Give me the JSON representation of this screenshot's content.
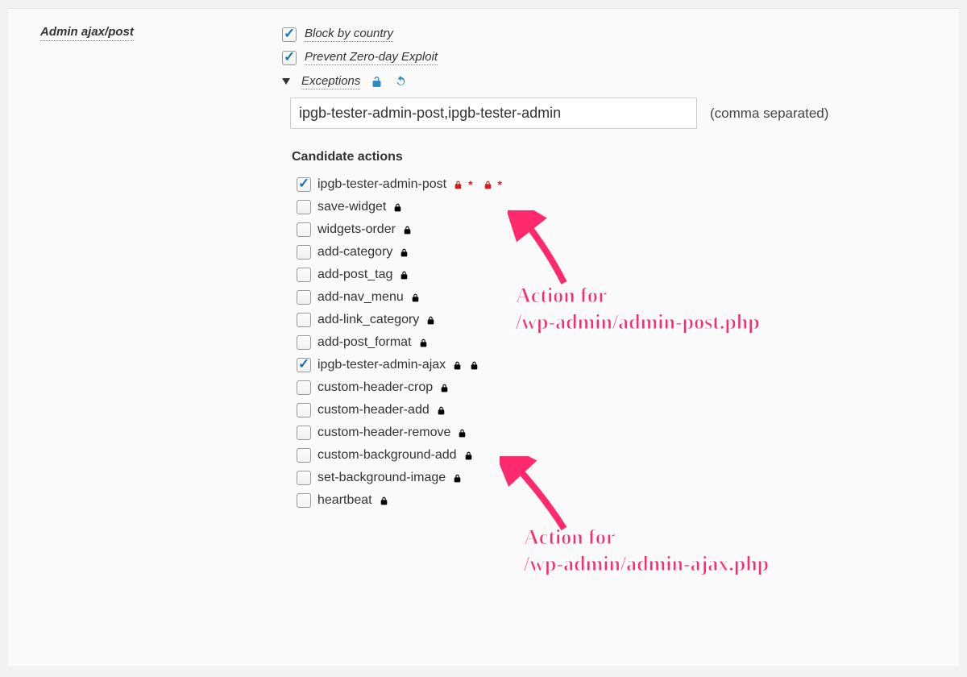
{
  "section_title": "Admin ajax/post",
  "options": {
    "block_label": "Block by country",
    "block_checked": true,
    "prevent_label": "Prevent Zero-day Exploit",
    "prevent_checked": true
  },
  "exceptions": {
    "label": "Exceptions",
    "value": "ipgb-tester-admin-post,ipgb-tester-admin",
    "hint": "(comma separated)"
  },
  "candidates_heading": "Candidate actions",
  "candidates": [
    {
      "label": "ipgb-tester-admin-post",
      "checked": true,
      "locks": [
        "red*",
        "red*"
      ]
    },
    {
      "label": "save-widget",
      "checked": false,
      "locks": [
        "black"
      ]
    },
    {
      "label": "widgets-order",
      "checked": false,
      "locks": [
        "black"
      ]
    },
    {
      "label": "add-category",
      "checked": false,
      "locks": [
        "black"
      ]
    },
    {
      "label": "add-post_tag",
      "checked": false,
      "locks": [
        "black"
      ]
    },
    {
      "label": "add-nav_menu",
      "checked": false,
      "locks": [
        "black"
      ]
    },
    {
      "label": "add-link_category",
      "checked": false,
      "locks": [
        "black"
      ]
    },
    {
      "label": "add-post_format",
      "checked": false,
      "locks": [
        "black"
      ]
    },
    {
      "label": "ipgb-tester-admin-ajax",
      "checked": true,
      "locks": [
        "black",
        "black"
      ]
    },
    {
      "label": "custom-header-crop",
      "checked": false,
      "locks": [
        "black"
      ]
    },
    {
      "label": "custom-header-add",
      "checked": false,
      "locks": [
        "black"
      ]
    },
    {
      "label": "custom-header-remove",
      "checked": false,
      "locks": [
        "black"
      ]
    },
    {
      "label": "custom-background-add",
      "checked": false,
      "locks": [
        "black"
      ]
    },
    {
      "label": "set-background-image",
      "checked": false,
      "locks": [
        "black"
      ]
    },
    {
      "label": "heartbeat",
      "checked": false,
      "locks": [
        "black"
      ]
    }
  ],
  "annotations": {
    "top": "Action for\n/wp-admin/admin-post.php",
    "bottom": "Action for\n/wp-admin/admin-ajax.php"
  }
}
